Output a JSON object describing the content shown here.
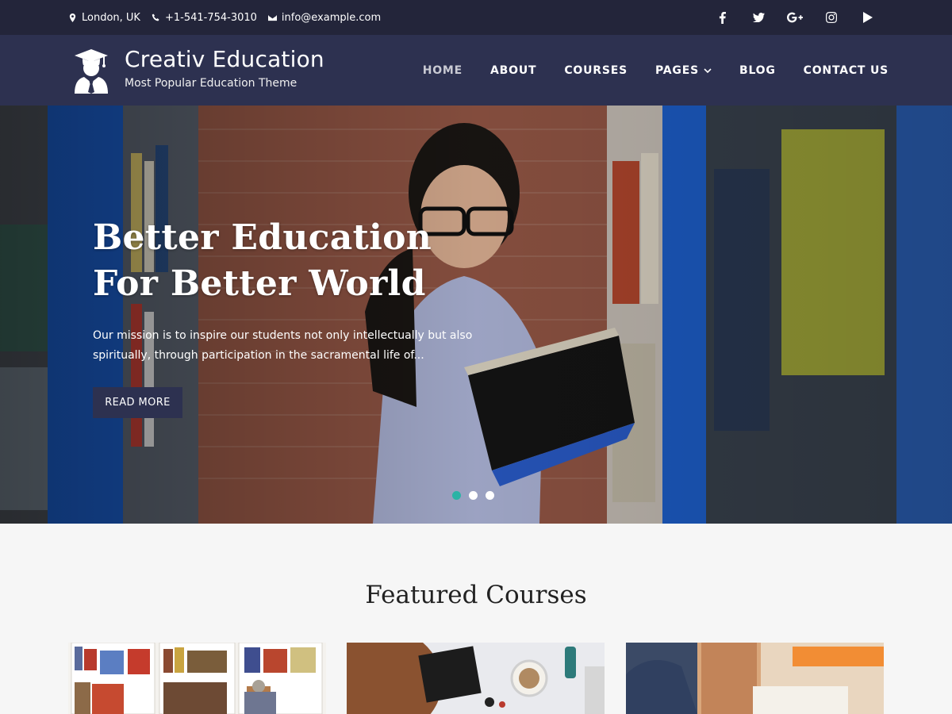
{
  "topbar": {
    "location": "London, UK",
    "phone": "+1-541-754-3010",
    "email": "info@example.com",
    "icons": [
      "map-marker-icon",
      "phone-icon",
      "envelope-icon"
    ],
    "social": [
      "facebook-icon",
      "twitter-icon",
      "google-plus-icon",
      "instagram-icon",
      "youtube-play-icon"
    ]
  },
  "header": {
    "site_title": "Creativ Education",
    "tagline": "Most Popular Education Theme",
    "nav": [
      {
        "label": "HOME"
      },
      {
        "label": "ABOUT"
      },
      {
        "label": "COURSES"
      },
      {
        "label": "PAGES"
      },
      {
        "label": "BLOG"
      },
      {
        "label": "CONTACT US"
      }
    ]
  },
  "hero": {
    "headline": "Better Education For Better World",
    "description": "Our mission is to inspire our students not only intellectually but also spiritually, through participation in the sacramental life of...",
    "button": "READ MORE",
    "slides": 3,
    "active_slide": 1
  },
  "featured": {
    "title": "Featured Courses",
    "cards": 3
  },
  "colors": {
    "topbar": "#23253a",
    "header": "#2d3150",
    "accent": "#2bb3a5",
    "section_bg": "#f6f6f6"
  }
}
